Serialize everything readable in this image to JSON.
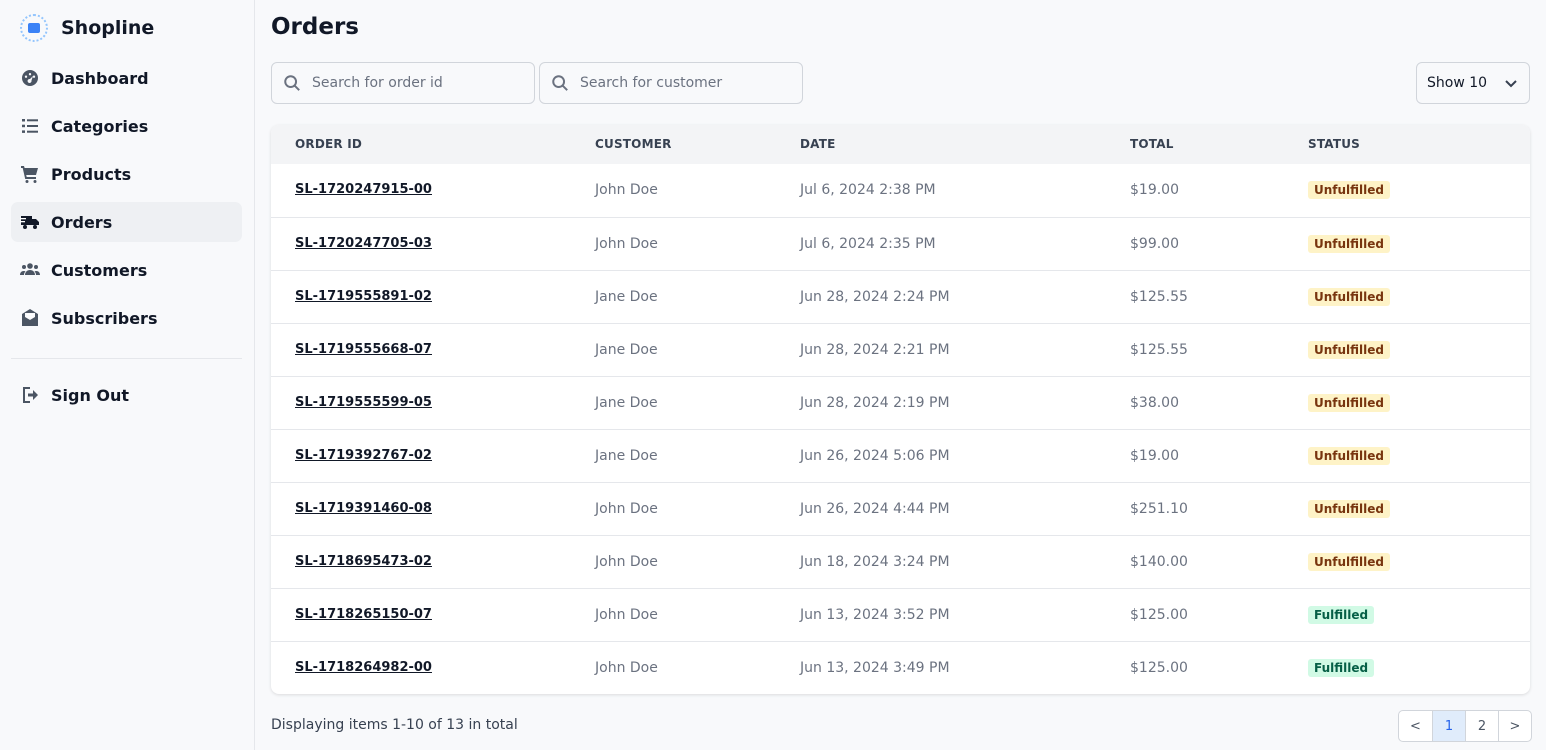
{
  "brand": {
    "name": "Shopline"
  },
  "sidebar": {
    "items": [
      {
        "label": "Dashboard",
        "icon": "dashboard-icon"
      },
      {
        "label": "Categories",
        "icon": "list-icon"
      },
      {
        "label": "Products",
        "icon": "cart-icon"
      },
      {
        "label": "Orders",
        "icon": "truck-icon",
        "active": true
      },
      {
        "label": "Customers",
        "icon": "users-icon"
      },
      {
        "label": "Subscribers",
        "icon": "envelope-open-icon"
      }
    ],
    "signout": {
      "label": "Sign Out",
      "icon": "sign-out-icon"
    }
  },
  "main": {
    "title": "Orders",
    "search_order": {
      "placeholder": "Search for order id",
      "value": ""
    },
    "search_customer": {
      "placeholder": "Search for customer",
      "value": ""
    },
    "show_select": {
      "value": "Show 10"
    },
    "table": {
      "headers": [
        "ORDER ID",
        "CUSTOMER",
        "DATE",
        "TOTAL",
        "STATUS"
      ],
      "rows": [
        {
          "order_id": "SL-1720247915-00",
          "customer": "John Doe",
          "date": "Jul 6, 2024 2:38 PM",
          "total": "$19.00",
          "status": "Unfulfilled"
        },
        {
          "order_id": "SL-1720247705-03",
          "customer": "John Doe",
          "date": "Jul 6, 2024 2:35 PM",
          "total": "$99.00",
          "status": "Unfulfilled"
        },
        {
          "order_id": "SL-1719555891-02",
          "customer": "Jane Doe",
          "date": "Jun 28, 2024 2:24 PM",
          "total": "$125.55",
          "status": "Unfulfilled"
        },
        {
          "order_id": "SL-1719555668-07",
          "customer": "Jane Doe",
          "date": "Jun 28, 2024 2:21 PM",
          "total": "$125.55",
          "status": "Unfulfilled"
        },
        {
          "order_id": "SL-1719555599-05",
          "customer": "Jane Doe",
          "date": "Jun 28, 2024 2:19 PM",
          "total": "$38.00",
          "status": "Unfulfilled"
        },
        {
          "order_id": "SL-1719392767-02",
          "customer": "Jane Doe",
          "date": "Jun 26, 2024 5:06 PM",
          "total": "$19.00",
          "status": "Unfulfilled"
        },
        {
          "order_id": "SL-1719391460-08",
          "customer": "John Doe",
          "date": "Jun 26, 2024 4:44 PM",
          "total": "$251.10",
          "status": "Unfulfilled"
        },
        {
          "order_id": "SL-1718695473-02",
          "customer": "John Doe",
          "date": "Jun 18, 2024 3:24 PM",
          "total": "$140.00",
          "status": "Unfulfilled"
        },
        {
          "order_id": "SL-1718265150-07",
          "customer": "John Doe",
          "date": "Jun 13, 2024 3:52 PM",
          "total": "$125.00",
          "status": "Fulfilled"
        },
        {
          "order_id": "SL-1718264982-00",
          "customer": "John Doe",
          "date": "Jun 13, 2024 3:49 PM",
          "total": "$125.00",
          "status": "Fulfilled"
        }
      ]
    },
    "footer": {
      "summary": "Displaying items 1-10 of 13 in total"
    },
    "pagination": {
      "prev": "<",
      "pages": [
        "1",
        "2"
      ],
      "current": "1",
      "next": ">"
    }
  },
  "colors": {
    "unfulfilled_bg": "#fef3c7",
    "fulfilled_bg": "#d1fae5",
    "active_page": "#2563eb"
  }
}
